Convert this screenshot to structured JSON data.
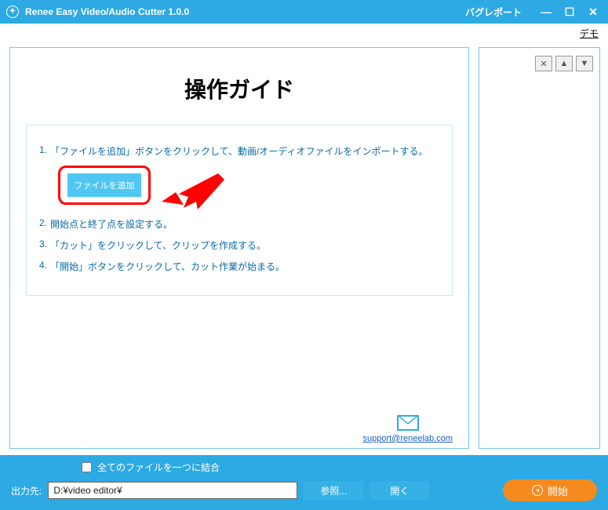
{
  "titlebar": {
    "app_title": "Renee Easy Video/Audio Cutter 1.0.0",
    "bug_report": "バグレポート"
  },
  "demo_link": "デモ",
  "guide": {
    "title": "操作ガイド",
    "steps": {
      "n1": "1.",
      "s1": "「ファイルを追加」ボタンをクリックして、動画/オーディオファイルをインポートする。",
      "add_file_btn": "ファイルを追加",
      "n2": "2.",
      "s2": "開始点と終了点を設定する。",
      "n3": "3.",
      "s3": "「カット」をクリックして、クリップを作成する。",
      "n4": "4.",
      "s4": "「開始」ボタンをクリックして、カット作業が始まる。"
    }
  },
  "support_email": "support@reneelab.com",
  "bottom": {
    "merge_label": "全てのファイルを一つに結合",
    "output_label": "出力先:",
    "output_value": "D:¥video editor¥",
    "browse": "参照...",
    "open": "開く",
    "start": "開始"
  }
}
